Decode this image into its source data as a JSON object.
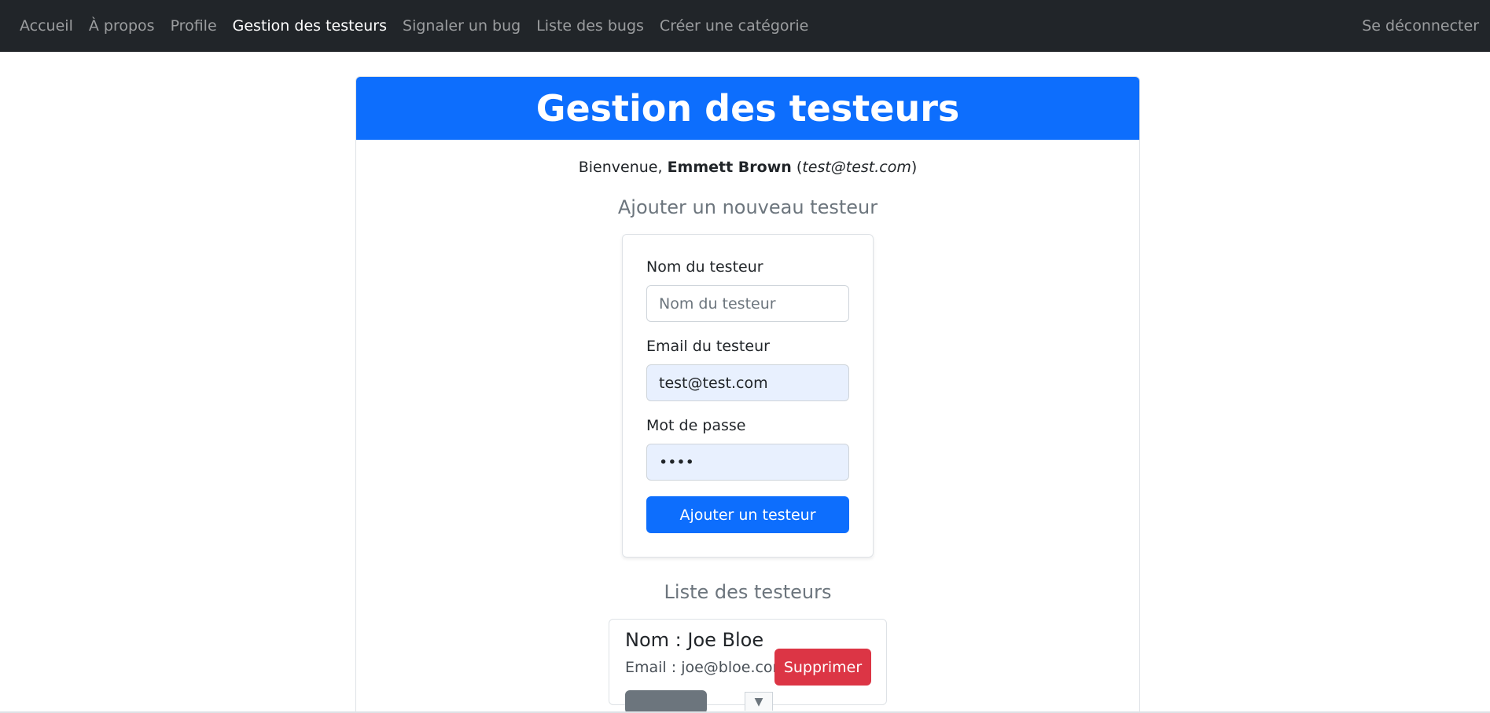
{
  "navbar": {
    "items": [
      {
        "label": "Accueil",
        "active": false
      },
      {
        "label": "À propos",
        "active": false
      },
      {
        "label": "Profile",
        "active": false
      },
      {
        "label": "Gestion des testeurs",
        "active": true
      },
      {
        "label": "Signaler un bug",
        "active": false
      },
      {
        "label": "Liste des bugs",
        "active": false
      },
      {
        "label": "Créer une catégorie",
        "active": false
      }
    ],
    "logout_label": "Se déconnecter"
  },
  "header": {
    "title": "Gestion des testeurs"
  },
  "welcome": {
    "prefix": "Bienvenue, ",
    "user_name": "Emmett Brown",
    "open_paren": " (",
    "user_email": "test@test.com",
    "close_paren": ")"
  },
  "add_form": {
    "title": "Ajouter un nouveau testeur",
    "name_label": "Nom du testeur",
    "name_placeholder": "Nom du testeur",
    "name_value": "",
    "email_label": "Email du testeur",
    "email_value": "test@test.com",
    "password_label": "Mot de passe",
    "password_value": "test",
    "submit_label": "Ajouter un testeur"
  },
  "testers": {
    "title": "Liste des testeurs",
    "items": [
      {
        "name_text": "Nom : Joe Bloe",
        "email_text": "Email : joe@bloe.com",
        "delete_label": "Supprimer"
      }
    ]
  },
  "colors": {
    "navbar_bg": "#212529",
    "primary": "#0d6efd",
    "danger": "#dc3545",
    "muted": "#6c757d",
    "autofill_bg": "#e8f0fe"
  }
}
